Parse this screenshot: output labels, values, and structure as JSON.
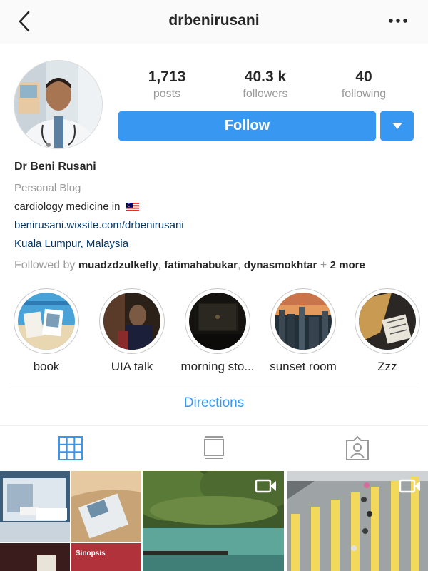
{
  "header": {
    "username": "drbenirusani",
    "back_icon": "chevron-left-icon",
    "more_icon": "more-horizontal-icon"
  },
  "stats": {
    "posts": {
      "value": "1,713",
      "label": "posts"
    },
    "followers": {
      "value": "40.3 k",
      "label": "followers"
    },
    "following": {
      "value": "40",
      "label": "following"
    }
  },
  "actions": {
    "follow_label": "Follow",
    "dropdown_icon": "caret-down-icon"
  },
  "profile": {
    "full_name": "Dr Beni Rusani",
    "category": "Personal Blog",
    "bio": "cardiology medicine in",
    "bio_flag": "malaysia-flag-icon",
    "website": "benirusani.wixsite.com/drbenirusani",
    "location": "Kuala Lumpur, Malaysia"
  },
  "followed_by": {
    "prefix": "Followed by",
    "users": [
      "muadzdzulkefly",
      "fatimahabukar",
      "dynasmokhtar"
    ],
    "more": "+ 2 more"
  },
  "highlights": [
    {
      "label": "book"
    },
    {
      "label": "UIA talk"
    },
    {
      "label": "morning sto..."
    },
    {
      "label": "sunset room"
    },
    {
      "label": "Zzz"
    }
  ],
  "directions_label": "Directions",
  "tabs": [
    {
      "icon": "grid-icon",
      "active": true
    },
    {
      "icon": "feed-list-icon",
      "active": false
    },
    {
      "icon": "tagged-person-icon",
      "active": false
    }
  ],
  "grid_posts": [
    {
      "type": "image",
      "text": "Sinopsis"
    },
    {
      "type": "video",
      "icon": "video-camera-icon"
    },
    {
      "type": "video",
      "icon": "video-camera-icon"
    }
  ],
  "colors": {
    "accent": "#3897f0",
    "link": "#003569",
    "muted": "#999999",
    "text": "#262626"
  }
}
